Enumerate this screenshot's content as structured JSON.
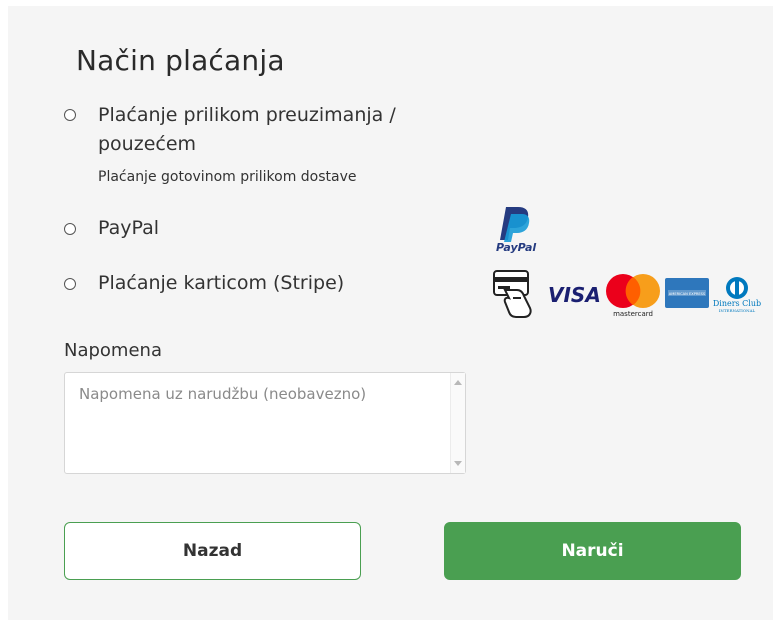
{
  "payment": {
    "title": "Način plaćanja",
    "options": [
      {
        "label_line1": "Plaćanje prilikom preuzimanja /",
        "label_line2": "pouzećem",
        "description": "Plaćanje gotovinom prilikom dostave",
        "selected": false
      },
      {
        "label": "PayPal",
        "selected": false,
        "logo_text": "PayPal"
      },
      {
        "label": "Plaćanje karticom (Stripe)",
        "selected": false,
        "card_logos": {
          "visa": "VISA",
          "mastercard": "mastercard",
          "amex": "AMERICAN EXPRESS",
          "diners_line1": "Diners Club",
          "diners_line2": "INTERNATIONAL"
        }
      }
    ]
  },
  "note": {
    "label": "Napomena",
    "placeholder": "Napomena uz narudžbu (neobavezno)",
    "value": ""
  },
  "buttons": {
    "back": "Nazad",
    "order": "Naruči"
  },
  "colors": {
    "accent_green": "#4a9f51",
    "paypal_dark": "#253b80",
    "paypal_light": "#179bd7",
    "visa_blue": "#1a1f71",
    "mc_red": "#eb001b",
    "mc_orange": "#f79e1b",
    "amex_blue": "#2e77bc",
    "diners_blue": "#0079be"
  }
}
